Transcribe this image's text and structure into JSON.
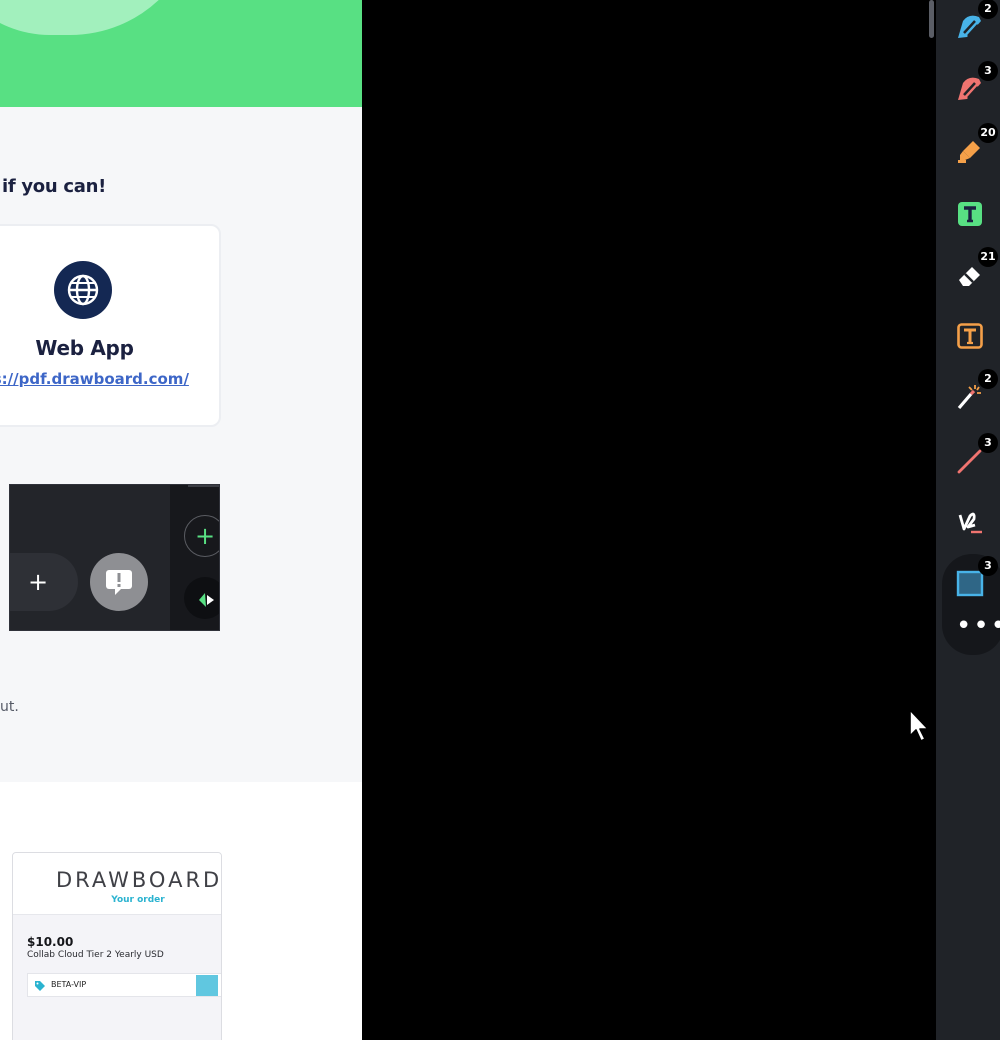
{
  "document": {
    "heading": "if you can!",
    "webapp_card": {
      "title": "Web App",
      "link": "ps://pdf.drawboard.com/"
    },
    "fragment_text": "ut.",
    "order_preview": {
      "brand": "DRAWBOARD",
      "subtitle": "Your order",
      "price": "$10.00",
      "plan": "Collab Cloud Tier 2 Yearly USD",
      "coupon_code": "BETA-VIP"
    }
  },
  "toolbar": {
    "tools": [
      {
        "icon": "highlighter-blue-icon",
        "count": "2",
        "color": "#48b3e8"
      },
      {
        "icon": "highlighter-red-icon",
        "count": "3",
        "color": "#f07470"
      },
      {
        "icon": "marker-orange-icon",
        "count": "20",
        "color": "#f5a049"
      },
      {
        "icon": "text-highlight-green-icon",
        "count": "",
        "color": "#58e083"
      },
      {
        "icon": "eraser-icon",
        "count": "21",
        "color": "#ffffff"
      },
      {
        "icon": "text-box-icon",
        "count": "",
        "color": "#f5a049"
      },
      {
        "icon": "magic-wand-icon",
        "count": "2",
        "color": "#ffffff"
      },
      {
        "icon": "line-tool-icon",
        "count": "3",
        "color": "#f07470"
      },
      {
        "icon": "signature-icon",
        "count": "",
        "color": "#ffffff"
      },
      {
        "icon": "rectangle-tool-icon",
        "count": "3",
        "color": "#48b3e8"
      }
    ],
    "more_label": "•••"
  }
}
